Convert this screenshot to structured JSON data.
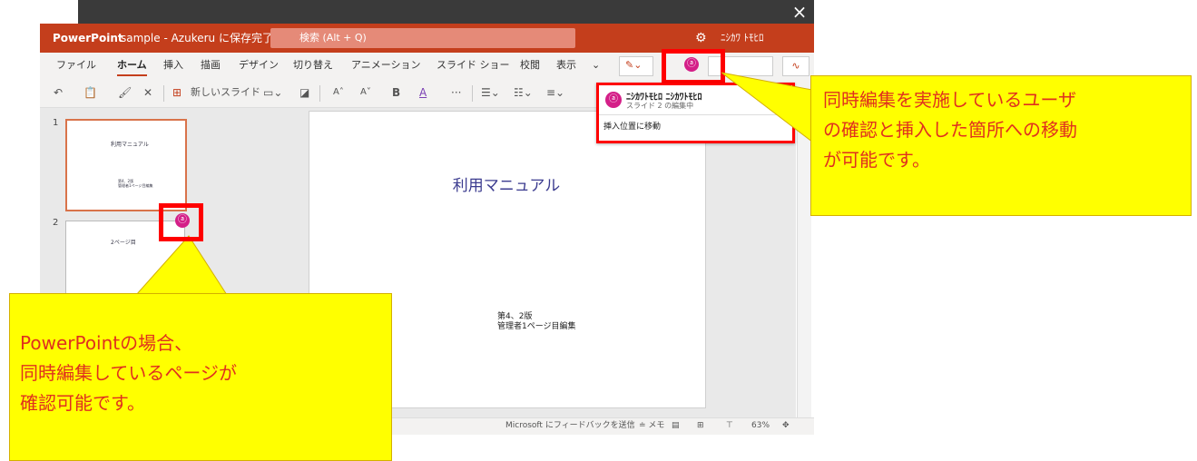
{
  "window": {
    "close_label": "×",
    "app_name": "PowerPoint",
    "doc_status": "sample - Azukeru に保存完了",
    "search_placeholder": "検索 (Alt + Q)",
    "user_name": "ﾆｼｶﾜ ﾄﾓﾋﾛ"
  },
  "ribbon": {
    "tabs": [
      "ファイル",
      "ホーム",
      "挿入",
      "描画",
      "デザイン",
      "切り替え",
      "アニメーション",
      "スライド ショー",
      "校閲",
      "表示"
    ],
    "active_tab": "ホーム",
    "new_slide_label": "新しいスライド",
    "tool_glyphs": {
      "undo": "↶",
      "paste": "📋",
      "format_painter": "🖌",
      "delete": "✕",
      "font_grow": "A˄",
      "font_shrink": "A˅",
      "bold": "B",
      "font_color": "A",
      "more": "···"
    }
  },
  "thumbnails": [
    {
      "number": "1",
      "title": "利用マニュアル",
      "sub1": "第4、2版",
      "sub2": "管理者1ページ目編集",
      "selected": true
    },
    {
      "number": "2",
      "title": "2ページ目",
      "selected": false
    }
  ],
  "slide": {
    "title": "利用マニュアル",
    "subtitle_line1": "第4、2版",
    "subtitle_line2": "管理者1ページ目編集"
  },
  "status_bar": {
    "feedback": "Microsoft にフィードバックを送信",
    "notes": "≐ メモ",
    "zoom": "63%"
  },
  "coauthor_popup": {
    "name": "ﾆｼｶﾜﾄﾓﾋﾛ ﾆｼｶﾜﾄﾓﾋﾛ",
    "status": "スライド 2 の編集中",
    "action": "挿入位置に移動"
  },
  "callouts": {
    "right_line1": "同時編集を実施しているユーザ",
    "right_line2": "の確認と挿入した箇所への移動",
    "right_line3": "が可能です。",
    "left_line1": "PowerPointの場合、",
    "left_line2": "同時編集しているページが",
    "left_line3": "確認可能です。"
  },
  "colors": {
    "accent": "#c43e1c",
    "callout_fill": "#ffff00",
    "callout_text": "#e0301e",
    "highlight": "#ff0000",
    "avatar": "#d41f88"
  },
  "icons": [
    "person-icon",
    "gear-icon",
    "pen-icon",
    "chevron-down-icon",
    "close-icon"
  ]
}
